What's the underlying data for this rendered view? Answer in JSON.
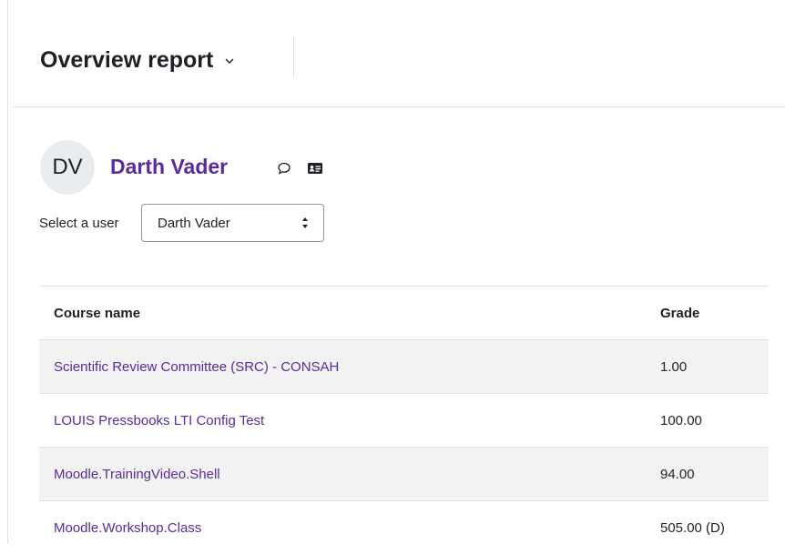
{
  "header": {
    "title": "Overview report"
  },
  "user": {
    "initials": "DV",
    "name": "Darth Vader",
    "message_icon": "chat-bubble-icon",
    "profile_icon": "contact-card-icon"
  },
  "selector": {
    "label": "Select a user",
    "selected": "Darth Vader"
  },
  "table": {
    "headers": [
      "Course name",
      "Grade"
    ],
    "rows": [
      {
        "course": "Scientific Review Committee (SRC) - CONSAH",
        "grade": "1.00"
      },
      {
        "course": "LOUIS Pressbooks LTI Config Test",
        "grade": "100.00"
      },
      {
        "course": "Moodle.TrainingVideo.Shell",
        "grade": "94.00"
      },
      {
        "course": "Moodle.Workshop.Class",
        "grade": "505.00 (D)"
      }
    ]
  },
  "colors": {
    "link": "#5b2a9b",
    "row_stripe": "#f2f2f2",
    "border": "#dee2e6"
  }
}
